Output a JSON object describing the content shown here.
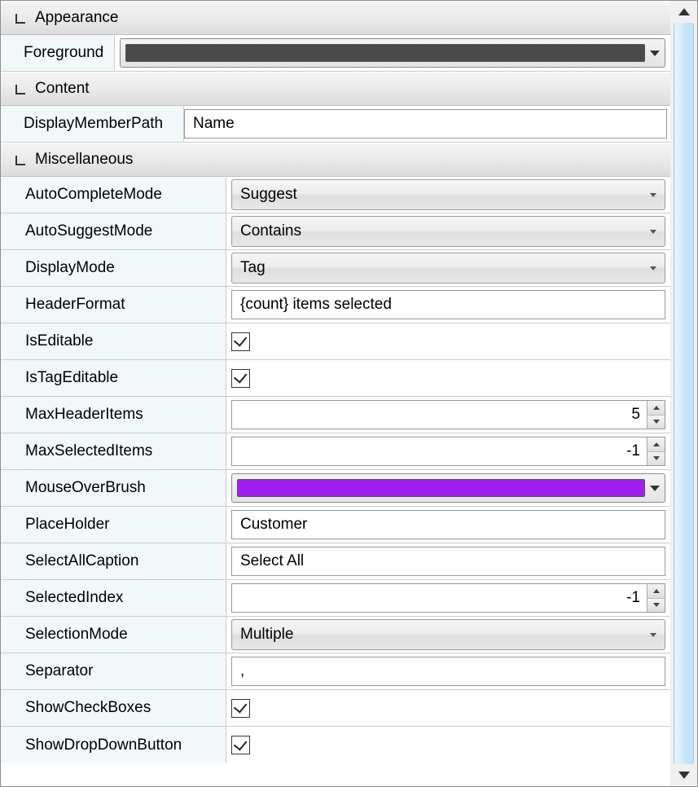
{
  "categories": {
    "appearance": {
      "label": "Appearance"
    },
    "content": {
      "label": "Content"
    },
    "miscellaneous": {
      "label": "Miscellaneous"
    }
  },
  "appearance": {
    "foreground_label": "Foreground",
    "foreground_color": "#4a4a4a"
  },
  "content": {
    "displaymemberpath_label": "DisplayMemberPath",
    "displaymemberpath_value": "Name"
  },
  "misc": {
    "autocompletemode_label": "AutoCompleteMode",
    "autocompletemode_value": "Suggest",
    "autosuggestmode_label": "AutoSuggestMode",
    "autosuggestmode_value": "Contains",
    "displaymode_label": "DisplayMode",
    "displaymode_value": "Tag",
    "headerformat_label": "HeaderFormat",
    "headerformat_value": "{count} items selected",
    "iseditable_label": "IsEditable",
    "iseditable_value": true,
    "istageditable_label": "IsTagEditable",
    "istageditable_value": true,
    "maxheaderitems_label": "MaxHeaderItems",
    "maxheaderitems_value": "5",
    "maxselecteditems_label": "MaxSelectedItems",
    "maxselecteditems_value": "-1",
    "mouseoverbrush_label": "MouseOverBrush",
    "mouseoverbrush_color": "#a020f0",
    "placeholder_label": "PlaceHolder",
    "placeholder_value": "Customer",
    "selectallcaption_label": "SelectAllCaption",
    "selectallcaption_value": "Select All",
    "selectedindex_label": "SelectedIndex",
    "selectedindex_value": "-1",
    "selectionmode_label": "SelectionMode",
    "selectionmode_value": "Multiple",
    "separator_label": "Separator",
    "separator_value": ",",
    "showcheckboxes_label": "ShowCheckBoxes",
    "showcheckboxes_value": true,
    "showdropdownbutton_label": "ShowDropDownButton",
    "showdropdownbutton_value": true
  }
}
